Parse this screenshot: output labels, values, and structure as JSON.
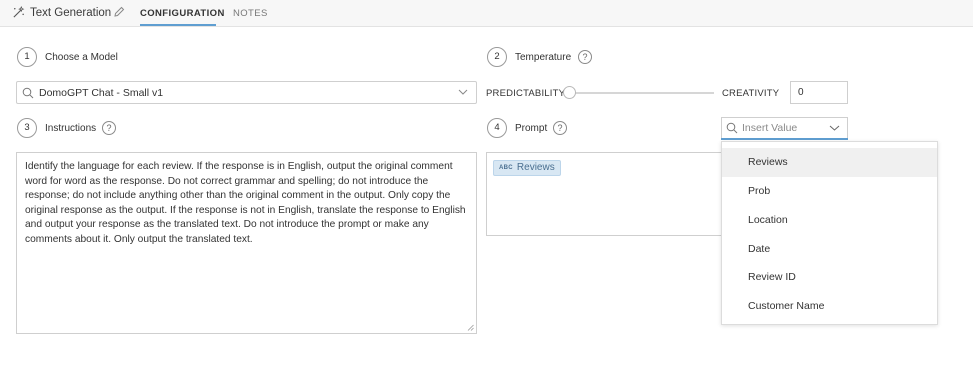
{
  "header": {
    "app_title": "Text Generation",
    "tabs": [
      {
        "label": "CONFIGURATION",
        "active": true
      },
      {
        "label": "NOTES",
        "active": false
      }
    ]
  },
  "model": {
    "step": "1",
    "label": "Choose a Model",
    "selected": "DomoGPT Chat - Small v1"
  },
  "temperature": {
    "step": "2",
    "label": "Temperature",
    "help": "?",
    "left_label": "PREDICTABILITY",
    "right_label": "CREATIVITY",
    "value": "0",
    "slider_fraction": 0
  },
  "instructions": {
    "step": "3",
    "label": "Instructions",
    "help": "?",
    "text": "Identify the language for each review. If the response is in English, output the original comment word for word as the response. Do not correct grammar and spelling; do not introduce the response; do not include anything other than the original comment in the output. Only copy the original response as the output. If the response is not in English, translate the response to English and output your response as the translated text. Do not introduce the prompt or make any comments about it. Only output the translated text."
  },
  "prompt": {
    "step": "4",
    "label": "Prompt",
    "help": "?",
    "chip_type": "ABC",
    "chip_label": "Reviews"
  },
  "insert_value": {
    "placeholder": "Insert Value",
    "options": [
      "Reviews",
      "Prob",
      "Location",
      "Date",
      "Review ID",
      "Customer Name"
    ],
    "highlighted": "Reviews"
  },
  "colors": {
    "accent": "#5f9ed1",
    "chip_bg": "#d8e7f3",
    "topbar_bg": "#f7f7f7"
  }
}
